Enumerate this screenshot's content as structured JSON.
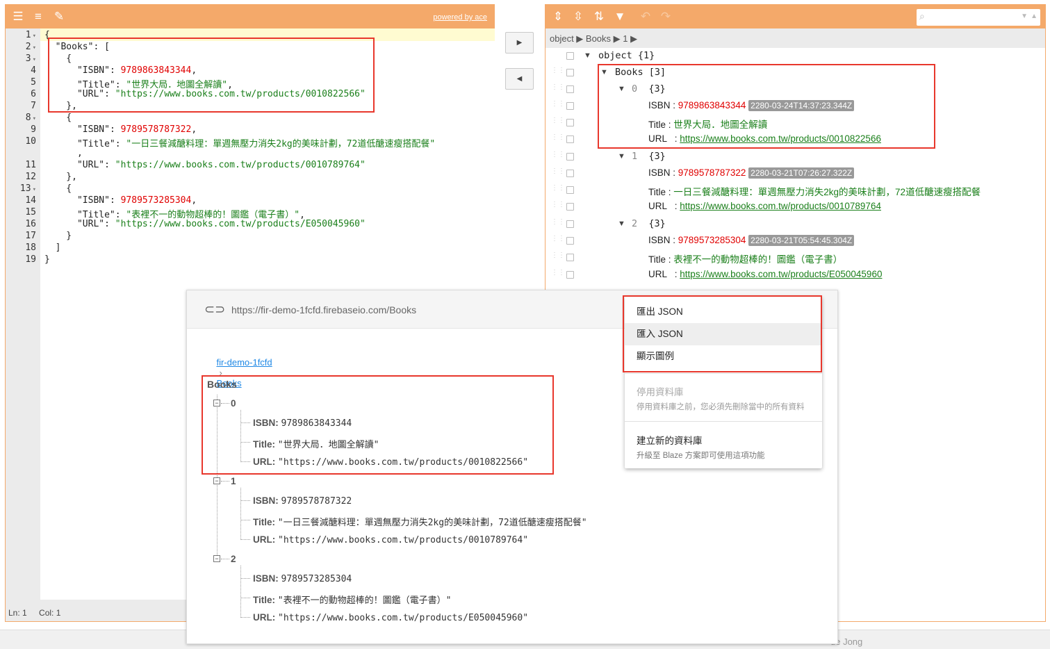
{
  "left_editor": {
    "powered_by": "powered by ace",
    "status_ln": "Ln: 1",
    "status_col": "Col: 1",
    "line_numbers": [
      "1",
      "2",
      "3",
      "4",
      "5",
      "6",
      "7",
      "8",
      "9",
      "10",
      "",
      "11",
      "12",
      "13",
      "14",
      "15",
      "16",
      "17",
      "18",
      "19"
    ]
  },
  "books": [
    {
      "isbn": "9789863843344",
      "title": "世界大局．地圖全解讀",
      "url": "https://www.books.com.tw/products/0010822566",
      "date": "2280-03-24T14:37:23.344Z"
    },
    {
      "isbn": "9789578787322",
      "title": "一日三餐減醣料理：單週無壓力消失2kg的美味計劃，72道低醣速瘦搭配餐",
      "url": "https://www.books.com.tw/products/0010789764",
      "date": "2280-03-21T07:26:27.322Z"
    },
    {
      "isbn": "9789573285304",
      "title": "表裡不一的動物超棒的！圖鑑（電子書）",
      "url": "https://www.books.com.tw/products/E050045960",
      "date": "2280-03-21T05:54:45.304Z"
    }
  ],
  "code": {
    "books_key": "\"Books\"",
    "isbn_key": "\"ISBN\"",
    "title_key": "\"Title\"",
    "url_key": "\"URL\""
  },
  "right_tree": {
    "breadcrumb": "object ▶ Books ▶ 1 ▶",
    "root_label": "object",
    "root_count": "{1}",
    "books_label": "Books",
    "books_count": "[3]",
    "idx0": "0",
    "idx1": "1",
    "idx2": "2",
    "item_count": "{3}",
    "isbn_label": "ISBN",
    "title_label": "Title",
    "url_label": "URL",
    "sep": " : "
  },
  "firebase": {
    "db_url": "https://fir-demo-1fcfd.firebaseio.com/Books",
    "crumb_root": "fir-demo-1fcfd",
    "crumb_sep": "›",
    "crumb_child": "Books",
    "node_title": "Books",
    "idx0": "0",
    "idx1": "1",
    "idx2": "2",
    "isbn_label": "ISBN:",
    "title_label": "Title:",
    "url_label": "URL:",
    "title_0": "\"世界大局．地圖全解讀\"",
    "title_1": "\"一日三餐減醣料理：單週無壓力消失2kg的美味計劃，72道低醣速瘦搭配餐\"",
    "title_2": "\"表裡不一的動物超棒的！圖鑑（電子書）\"",
    "url_0": "\"https://www.books.com.tw/products/0010822566\"",
    "url_1": "\"https://www.books.com.tw/products/0010789764\"",
    "url_2": "\"https://www.books.com.tw/products/E050045960\""
  },
  "menu": {
    "export": "匯出 JSON",
    "import": "匯入 JSON",
    "legend": "顯示圖例",
    "disable_db": "停用資料庫",
    "disable_db_sub": "停用資料庫之前，您必須先刪除當中的所有資料",
    "create_db": "建立新的資料庫",
    "create_db_sub": "升級至 Blaze 方案即可使用這項功能"
  },
  "footer": {
    "partial_text": "de Jong"
  }
}
